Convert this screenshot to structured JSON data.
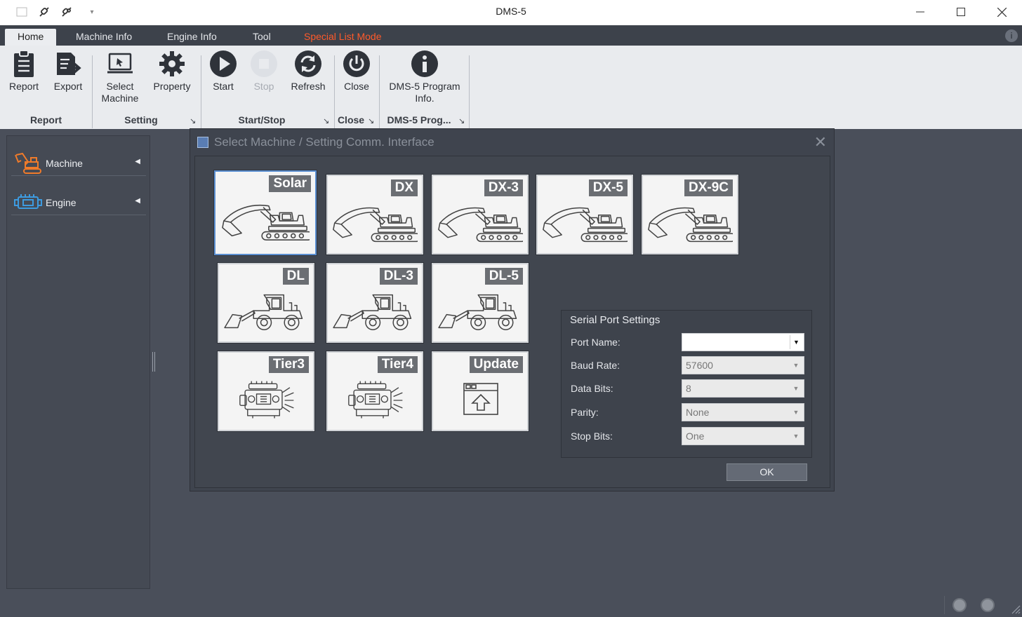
{
  "window": {
    "title": "DMS-5"
  },
  "menu": {
    "tabs": [
      {
        "label": "Home"
      },
      {
        "label": "Machine Info"
      },
      {
        "label": "Engine Info"
      },
      {
        "label": "Tool"
      },
      {
        "label": "Special List Mode"
      }
    ]
  },
  "ribbon": {
    "buttons": {
      "report": "Report",
      "export": "Export",
      "select_machine_1": "Select",
      "select_machine_2": "Machine",
      "property": "Property",
      "start": "Start",
      "stop": "Stop",
      "refresh": "Refresh",
      "close": "Close",
      "program_info_1": "DMS-5 Program",
      "program_info_2": "Info."
    },
    "groups": {
      "report": "Report",
      "setting": "Setting",
      "start_stop": "Start/Stop",
      "close": "Close",
      "program": "DMS-5 Prog..."
    }
  },
  "sidebar": {
    "items": [
      {
        "label": "Machine"
      },
      {
        "label": "Engine"
      }
    ]
  },
  "dialog": {
    "title": "Select Machine / Setting Comm. Interface",
    "tiles": [
      {
        "label": "Solar"
      },
      {
        "label": "DX"
      },
      {
        "label": "DX-3"
      },
      {
        "label": "DX-5"
      },
      {
        "label": "DX-9C"
      },
      {
        "label": "DL"
      },
      {
        "label": "DL-3"
      },
      {
        "label": "DL-5"
      },
      {
        "label": "Tier3"
      },
      {
        "label": "Tier4"
      },
      {
        "label": "Update"
      }
    ],
    "serial": {
      "title": "Serial Port Settings",
      "port_name_label": "Port Name:",
      "port_name_value": "",
      "baud_rate_label": "Baud Rate:",
      "baud_rate_value": "57600",
      "data_bits_label": "Data Bits:",
      "data_bits_value": "8",
      "parity_label": "Parity:",
      "parity_value": "None",
      "stop_bits_label": "Stop Bits:",
      "stop_bits_value": "One"
    },
    "ok_label": "OK"
  }
}
